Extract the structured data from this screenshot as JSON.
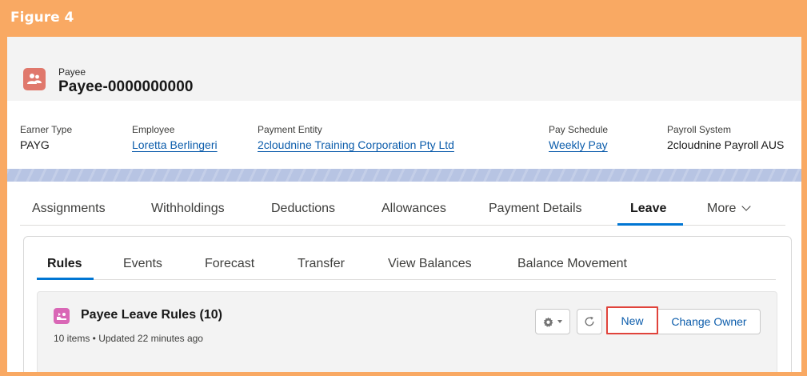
{
  "figure": {
    "label": "Figure 4"
  },
  "record": {
    "type_label": "Payee",
    "name": "Payee-0000000000",
    "icon": "payee-users-icon",
    "icon_color": "#e0786c"
  },
  "highlights": [
    {
      "label": "Earner Type",
      "value": "PAYG",
      "is_link": false
    },
    {
      "label": "Employee",
      "value": "Loretta Berlingeri",
      "is_link": true
    },
    {
      "label": "Payment Entity",
      "value": "2cloudnine Training Corporation Pty Ltd",
      "is_link": true
    },
    {
      "label": "Pay Schedule",
      "value": "Weekly Pay",
      "is_link": true
    },
    {
      "label": "Payroll System",
      "value": "2cloudnine Payroll AUS",
      "is_link": false
    }
  ],
  "main_tabs": {
    "items": [
      "Assignments",
      "Withholdings",
      "Deductions",
      "Allowances",
      "Payment Details",
      "Leave"
    ],
    "active": "Leave",
    "more_label": "More"
  },
  "sub_tabs": {
    "items": [
      "Rules",
      "Events",
      "Forecast",
      "Transfer",
      "View Balances",
      "Balance Movement"
    ],
    "active": "Rules"
  },
  "related_list": {
    "title": "Payee Leave Rules (10)",
    "meta": "10 items • Updated 22 minutes ago",
    "icon": "leave-rules-icon",
    "icon_color": "#d967b6",
    "buttons": {
      "new_label": "New",
      "change_owner_label": "Change Owner"
    }
  },
  "colors": {
    "accent": "#0176d3",
    "link": "#0b5cab",
    "frame": "#f9a963",
    "highlight_box": "#e0433b"
  }
}
